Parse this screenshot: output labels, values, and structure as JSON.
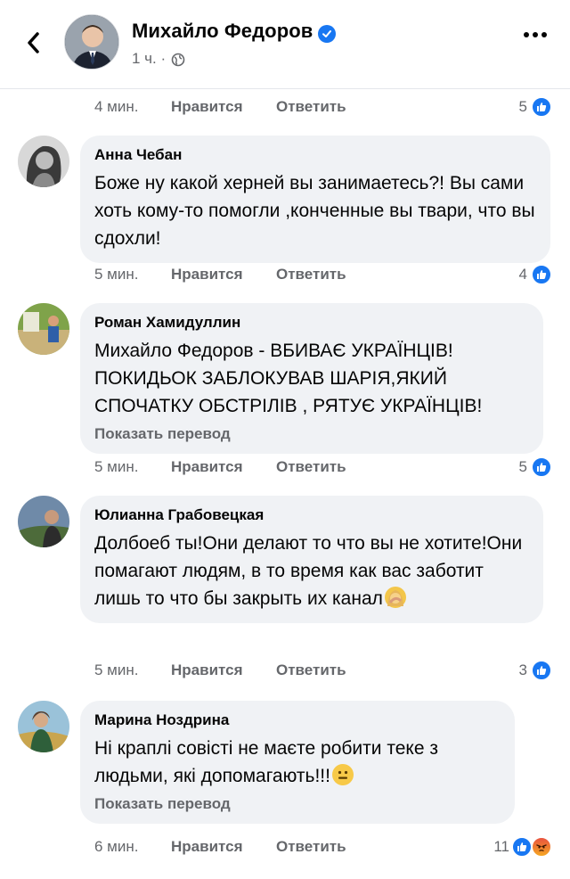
{
  "header": {
    "author": "Михайло Федоров",
    "post_time": "1 ч. ·"
  },
  "top_actions": {
    "time": "4 мин.",
    "like": "Нравится",
    "reply": "Ответить",
    "count": "5"
  },
  "comments": [
    {
      "name": "Анна Чебан",
      "text": "Боже ну какой херней вы занимаетесь?! Вы сами хоть кому-то помогли ,конченные вы твари, что вы сдохли!",
      "time": "5 мин.",
      "like": "Нравится",
      "reply": "Ответить",
      "count": "4"
    },
    {
      "name": "Роман Хамидуллин",
      "text": "Михайло Федоров - ВБИВАЄ УКРАЇНЦІВ! ПОКИДЬОК ЗАБЛОКУВАВ ШАРІЯ,ЯКИЙ СПОЧАТКУ ОБСТРІЛІВ , РЯТУЄ УКРАЇНЦІВ!",
      "translate": "Показать перевод",
      "time": "5 мин.",
      "like": "Нравится",
      "reply": "Ответить",
      "count": "5"
    },
    {
      "name": "Юлианна Грабовецкая",
      "text": "Долбоеб ты!Они делают то что вы не хотите!Они помагают людям, в то время как вас заботит лишь то что бы закрыть их канал",
      "time": "5 мин.",
      "like": "Нравится",
      "reply": "Ответить",
      "count": "3"
    },
    {
      "name": "Марина Ноздрина",
      "text": "Ні краплі совісті не маєте робити теке з людьми, які допомагають!!!",
      "translate": "Показать перевод",
      "time": "6 мин.",
      "like": "Нравится",
      "reply": "Ответить",
      "count": "11"
    }
  ],
  "icons": {
    "back": "chevron-left-icon",
    "verified": "verified-badge-icon",
    "privacy": "globe-icon",
    "more": "more-dots-icon",
    "like_reaction": "like-reaction-icon",
    "angry_reaction": "angry-reaction-icon"
  },
  "colors": {
    "accent": "#1877f2",
    "bubble": "#f0f2f5",
    "secondary_text": "#65676b"
  }
}
